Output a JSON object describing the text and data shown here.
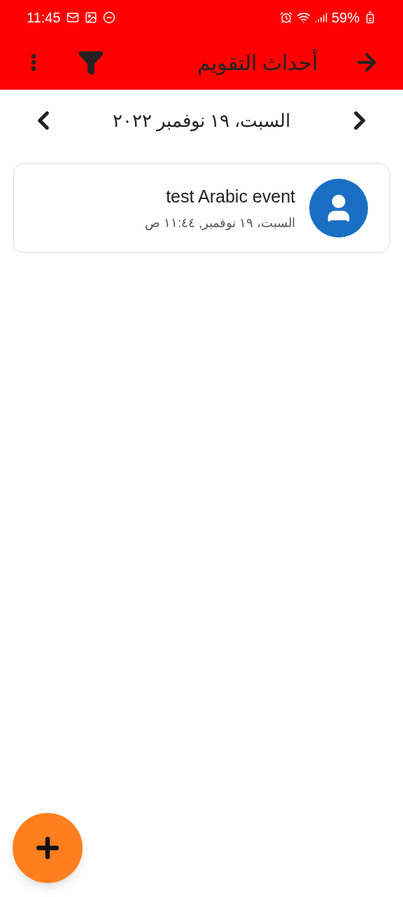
{
  "status_bar": {
    "time": "11:45",
    "battery": "59%"
  },
  "toolbar": {
    "title": "أحداث التقويم"
  },
  "date_nav": {
    "date": "السبت، ١٩ نوفمبر ٢٠٢٢"
  },
  "events": [
    {
      "title": "test Arabic event",
      "subtitle": "السبت، ١٩ نوفمبر, ١١:٤٤ ص"
    }
  ]
}
